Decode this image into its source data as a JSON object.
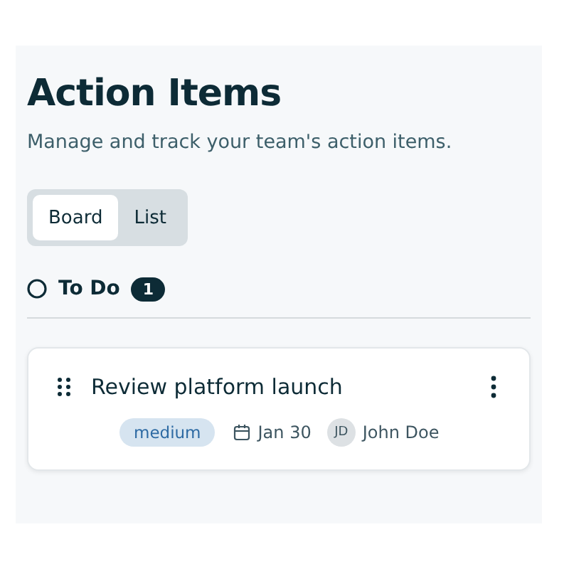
{
  "header": {
    "title": "Action Items",
    "subtitle": "Manage and track your team's action items."
  },
  "view_tabs": [
    {
      "label": "Board",
      "selected": true
    },
    {
      "label": "List",
      "selected": false
    }
  ],
  "column": {
    "title": "To Do",
    "count": "1"
  },
  "cards": [
    {
      "title": "Review platform launch",
      "priority": "medium",
      "due": "Jan 30",
      "assignee_initials": "JD",
      "assignee": "John Doe"
    }
  ]
}
